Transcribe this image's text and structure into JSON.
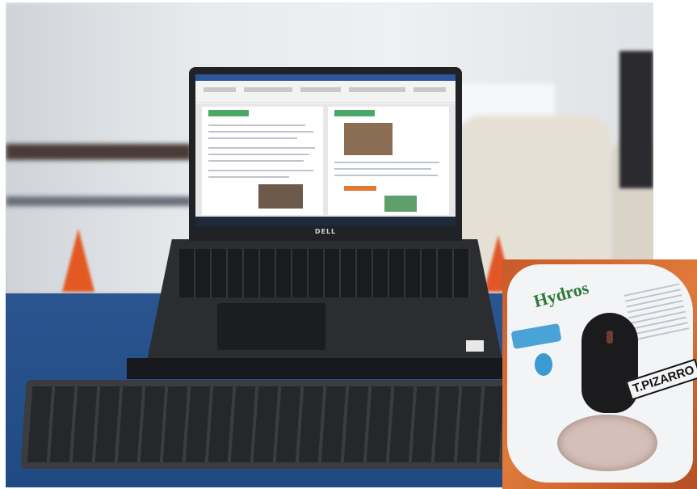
{
  "scene": {
    "laptop_brand": "DELL",
    "mousepad": {
      "brand": "Hydros",
      "name_label": "T.PIZARRO"
    }
  },
  "colors": {
    "table": "#1f4a82",
    "mousepad_background": "#d06a32",
    "brand_green": "#2f7a3a",
    "word_blue": "#2b579a"
  }
}
